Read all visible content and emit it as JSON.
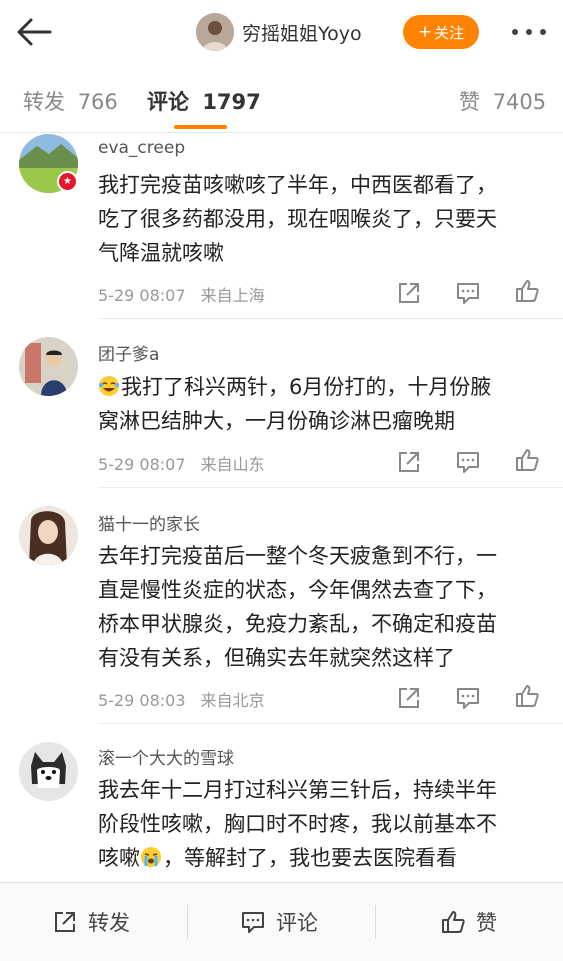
{
  "header": {
    "author_name": "穷摇姐姐Yoyo",
    "follow_label": "关注",
    "accent_color": "#ff8200"
  },
  "tabs": [
    {
      "label": "转发",
      "count": "766"
    },
    {
      "label": "评论",
      "count": "1797",
      "active": true
    },
    {
      "label": "赞",
      "count": "7405"
    }
  ],
  "comments": [
    {
      "username": "eva_creep",
      "lines": [
        "我打完疫苗咳嗽咳了半年，中西医都看了，",
        "吃了很多药都没用，现在咽喉炎了，只要天",
        "气降温就咳嗽"
      ],
      "time": "5-29 08:07",
      "location": "来自上海",
      "verified_badge": true
    },
    {
      "username": "团子爹a",
      "lines": [
        "我打了科兴两针，6月份打的，十月份腋",
        "窝淋巴结肿大，一月份确诊淋巴瘤晚期"
      ],
      "leading_emoji": "laugh-cry-emoji",
      "time": "5-29 08:07",
      "location": "来自山东"
    },
    {
      "username": "猫十一的家长",
      "lines": [
        "去年打完疫苗后一整个冬天疲惫到不行，一",
        "直是慢性炎症的状态，今年偶然去查了下，",
        "桥本甲状腺炎，免疫力紊乱，不确定和疫苗",
        "有没有关系，但确实去年就突然这样了"
      ],
      "time": "5-29 08:03",
      "location": "来自北京"
    },
    {
      "username": "滚一个大大的雪球",
      "lines": [
        "我去年十二月打过科兴第三针后，持续半年",
        "阶段性咳嗽，胸口时不时疼，我以前基本不",
        "咳嗽",
        "，等解封了，我也要去医院看看"
      ],
      "inline_emoji": "crying-emoji"
    }
  ],
  "bottom_bar": {
    "repost_label": "转发",
    "comment_label": "评论",
    "like_label": "赞"
  }
}
